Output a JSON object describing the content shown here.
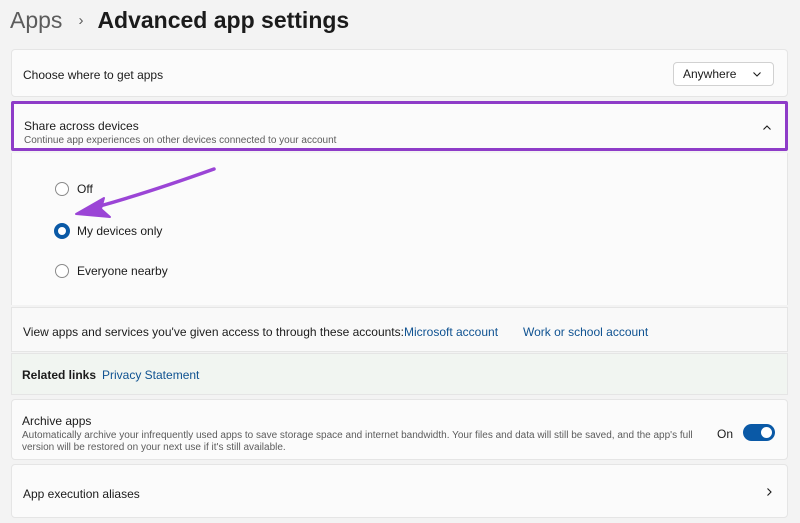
{
  "breadcrumb": {
    "parent": "Apps",
    "separator": "›",
    "current": "Advanced app settings"
  },
  "choose_where": {
    "label": "Choose where to get apps",
    "dropdown_value": "Anywhere"
  },
  "share_across": {
    "title": "Share across devices",
    "description": "Continue app experiences on other devices connected to your account",
    "expanded": true,
    "options": [
      {
        "label": "Off",
        "checked": false
      },
      {
        "label": "My devices only",
        "checked": true
      },
      {
        "label": "Everyone nearby",
        "checked": false
      }
    ]
  },
  "accounts": {
    "label": "View apps and services you've given access to through these accounts:",
    "microsoft_link": "Microsoft account",
    "work_link": "Work or school account"
  },
  "related_links": {
    "label": "Related links",
    "privacy_link": "Privacy Statement"
  },
  "archive_apps": {
    "title": "Archive apps",
    "description": "Automatically archive your infrequently used apps to save storage space and internet bandwidth. Your files and data will still be saved, and the app's full version will be restored on your next use if it's still available.",
    "toggle_label": "On",
    "toggle_on": true
  },
  "app_aliases": {
    "title": "App execution aliases"
  },
  "colors": {
    "accent": "#0a59a6",
    "highlight_box": "#8e3cc8",
    "annotation_arrow": "#9b45d6"
  }
}
